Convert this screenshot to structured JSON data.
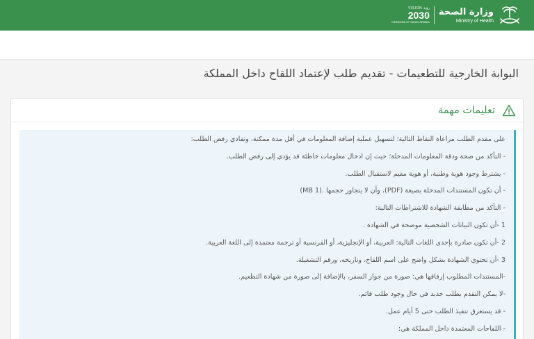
{
  "header": {
    "brand_ar": "وزارة الصحة",
    "brand_en": "Ministry of Health",
    "vision_top": "VISION رؤية",
    "vision_year": "2030",
    "vision_sub": "KINGDOM OF SAUDI ARABIA",
    "accent_color": "#39914d"
  },
  "page": {
    "title": "البوابة الخارجية للتطعيمات - تقديم طلب لإعتماد اللقاح داخل المملكة"
  },
  "instructions": {
    "icon": "warning-icon",
    "title": "تعليمات مهمة",
    "lines": [
      "على مقدم الطلب مراعاة النقاط التالية؛ لتسهيل عملية إضافة المعلومات في أقل مدة ممكنة، وتفادي رفض الطلب:",
      "- التأكد من صحة ودقة المعلومات المدخلة؛ حيث إن ادخال معلومات خاطئة قد يؤدي إلى رفض الطلب.",
      "- يشترط وجود هوية وطنية، أو هوية مقيم لاستقبال الطلب.",
      "- أن تكون المستندات المدخلة بصيغة (PDF)، وأن لا يتجاوز حجمها .(1 MB)",
      "- التأكد من مطابقة الشهادة للاشتراطات التالية:",
      "1 -أن تكون البيانات الشخصية موضحة في الشهادة .",
      "2 -أن تكون صادرة بإحدى اللغات التالية: العربية، أو الإنجليزية، أو الفرنسية أو ترجمة معتمدة إلى اللغة العربية.",
      "3 -أن تحتوي الشهادة بشكل واضح على اسم اللقاح، وتاريخه، ورقم التشغيلة.",
      "-المستندات المطلوب إرفاقها هي: صورة من جواز السفر، بالإضافة إلى صورة من شهادة التطعيم.",
      "-لا يمكن التقدم بطلب جديد في حال وجود طلب قائم.",
      "- قد يستغرق تنفيذ الطلب حتى 5 أيام عمل.",
      "- اللقاحات المعتمدة داخل المملكة هي:"
    ]
  }
}
